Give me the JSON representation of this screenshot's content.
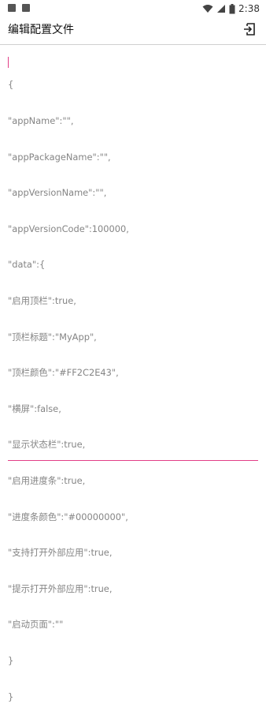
{
  "status_bar": {
    "time": "2:38",
    "left_icons": [
      "notification-square-icon",
      "notification-square-icon"
    ],
    "right_icons": [
      "wifi-icon",
      "signal-icon",
      "battery-icon"
    ]
  },
  "app_bar": {
    "title": "编辑配置文件",
    "action_icon": "exit-to-app-icon"
  },
  "editor": {
    "lines": [
      "{",
      "\"appName\":\"\",",
      "\"appPackageName\":\"\",",
      "\"appVersionName\":\"\",",
      "\"appVersionCode\":100000,",
      "\"data\":{",
      "\"启用顶栏\":true,",
      "\"顶栏标题\":\"MyApp\",",
      "\"顶栏颜色\":\"#FF2C2E43\",",
      "\"横屏\":false,",
      "\"显示状态栏\":true,",
      "\"启用进度条\":true,",
      "\"进度条颜色\":\"#00000000\",",
      "\"支持打开外部应用\":true,",
      "\"提示打开外部应用\":true,",
      "\"启动页面\":\"\"",
      "}",
      "}"
    ],
    "text_color": "#858585",
    "accent_color": "#e23e87"
  }
}
